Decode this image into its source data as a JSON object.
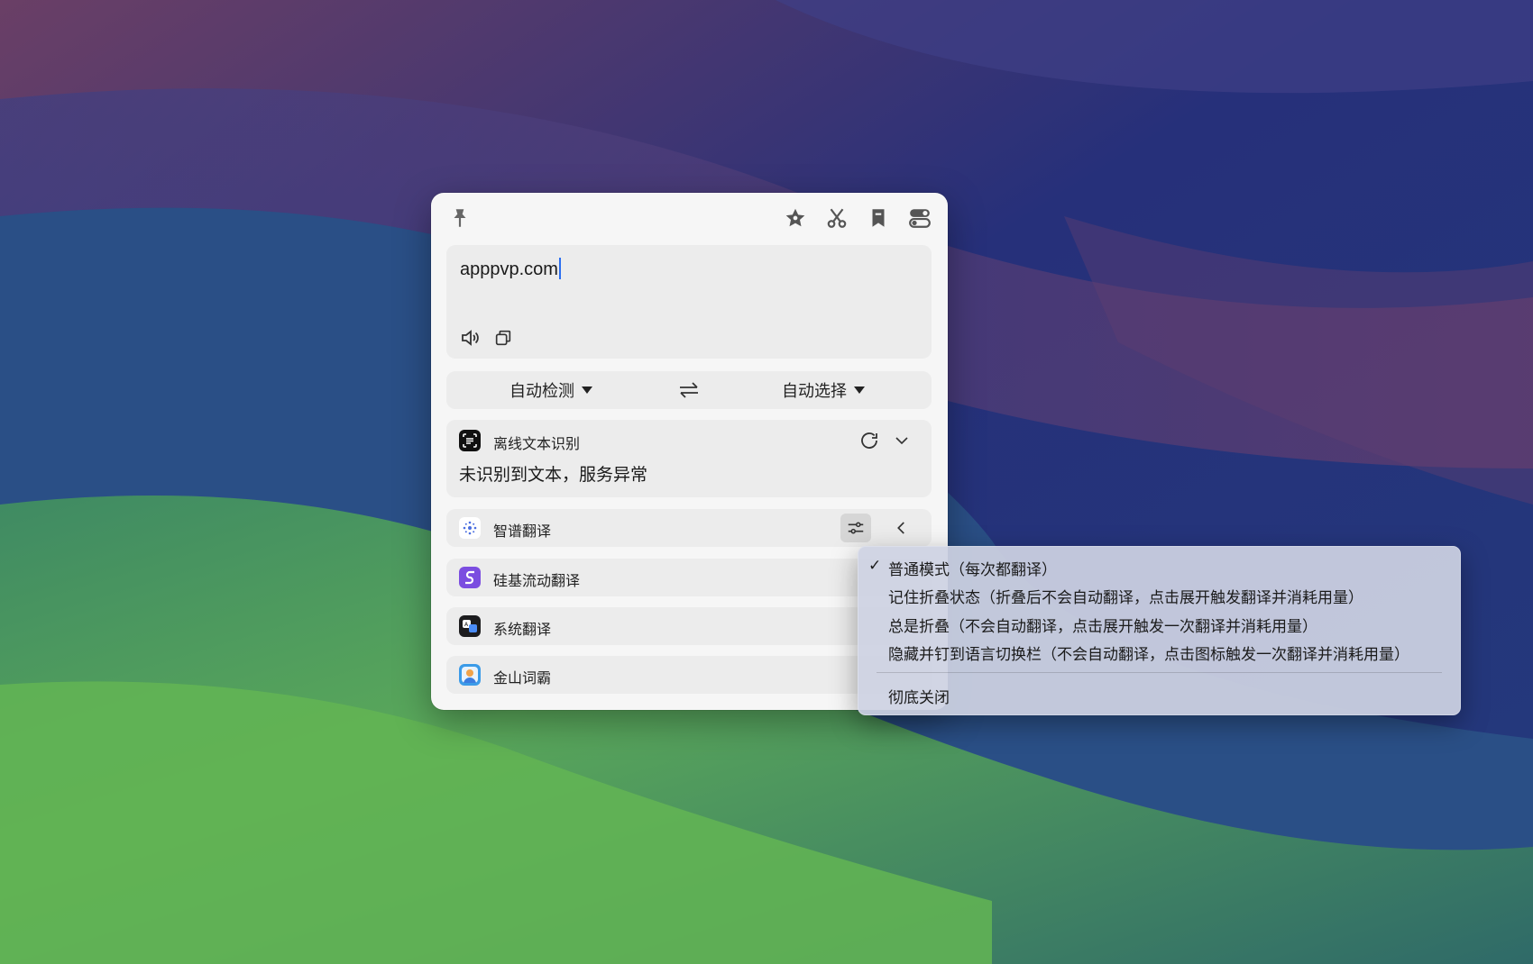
{
  "colors": {
    "window_bg": "#f6f6f6",
    "field_bg": "#ececec",
    "caret": "#2b6ef0",
    "menu_bg": "#cdd2e2"
  },
  "toolbar": {
    "left_icon": "pin-icon",
    "right_icons": [
      "star-icon",
      "scissors-icon",
      "bookmark-icon",
      "toggle-icon"
    ]
  },
  "input": {
    "text": "apppvp.com",
    "icons": [
      "speaker-icon",
      "copy-icon"
    ]
  },
  "language_bar": {
    "source": "自动检测",
    "swap_icon": "swap-icon",
    "target": "自动选择"
  },
  "services": [
    {
      "name": "离线文本识别",
      "icon": "ocr-icon",
      "message": "未识别到文本，服务异常"
    },
    {
      "name": "智谱翻译",
      "icon": "zhipu-icon"
    },
    {
      "name": "硅基流动翻译",
      "icon": "siliconflow-icon"
    },
    {
      "name": "系统翻译",
      "icon": "system-translate-icon"
    },
    {
      "name": "金山词霸",
      "icon": "iciba-icon"
    }
  ],
  "menu": {
    "checkmark": "✓",
    "items": [
      "普通模式（每次都翻译）",
      "记住折叠状态（折叠后不会自动翻译，点击展开触发翻译并消耗用量）",
      "总是折叠（不会自动翻译，点击展开触发一次翻译并消耗用量）",
      "隐藏并钉到语言切换栏（不会自动翻译，点击图标触发一次翻译并消耗用量）"
    ],
    "selected_index": 0,
    "close_all": "彻底关闭"
  }
}
